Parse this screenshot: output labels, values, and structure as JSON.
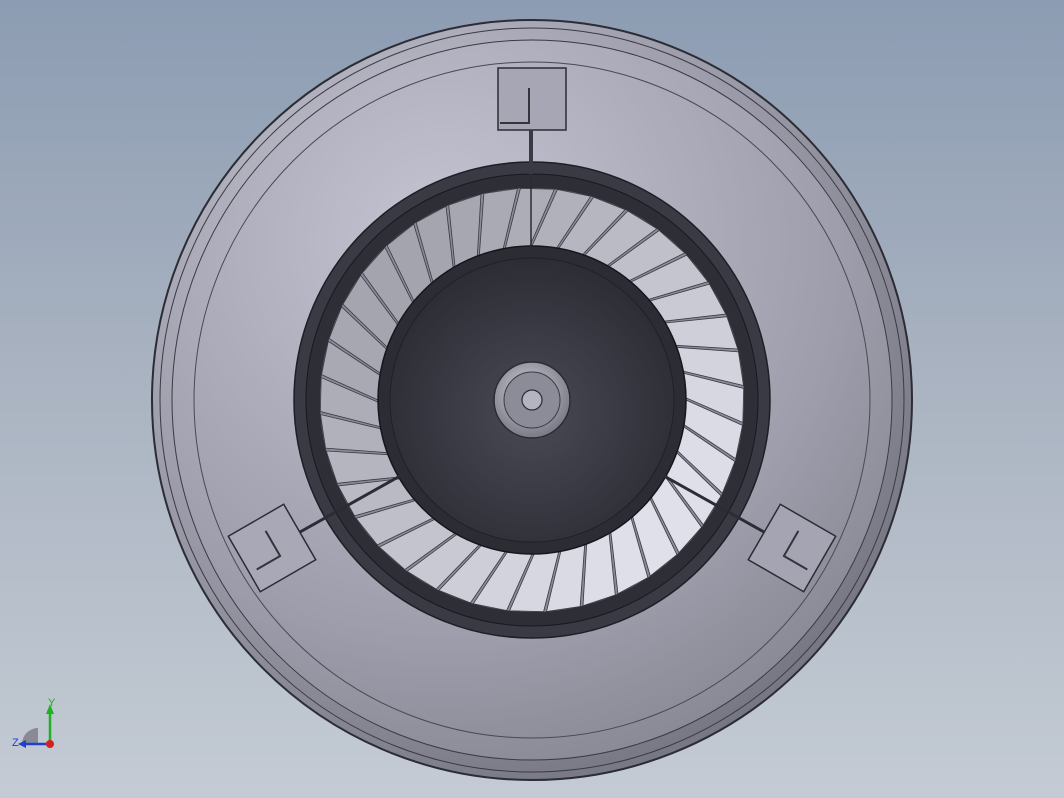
{
  "viewport": {
    "background_top": "#8c9cb2",
    "background_bottom": "#c4cbd4"
  },
  "model": {
    "part": "turbine-housing",
    "blade_count": 36,
    "sensor_mounts": 3
  },
  "triad": {
    "y_label": "Y",
    "z_label": "Z",
    "x_color": "#d42020",
    "y_color": "#20b020",
    "z_color": "#2040d0"
  }
}
